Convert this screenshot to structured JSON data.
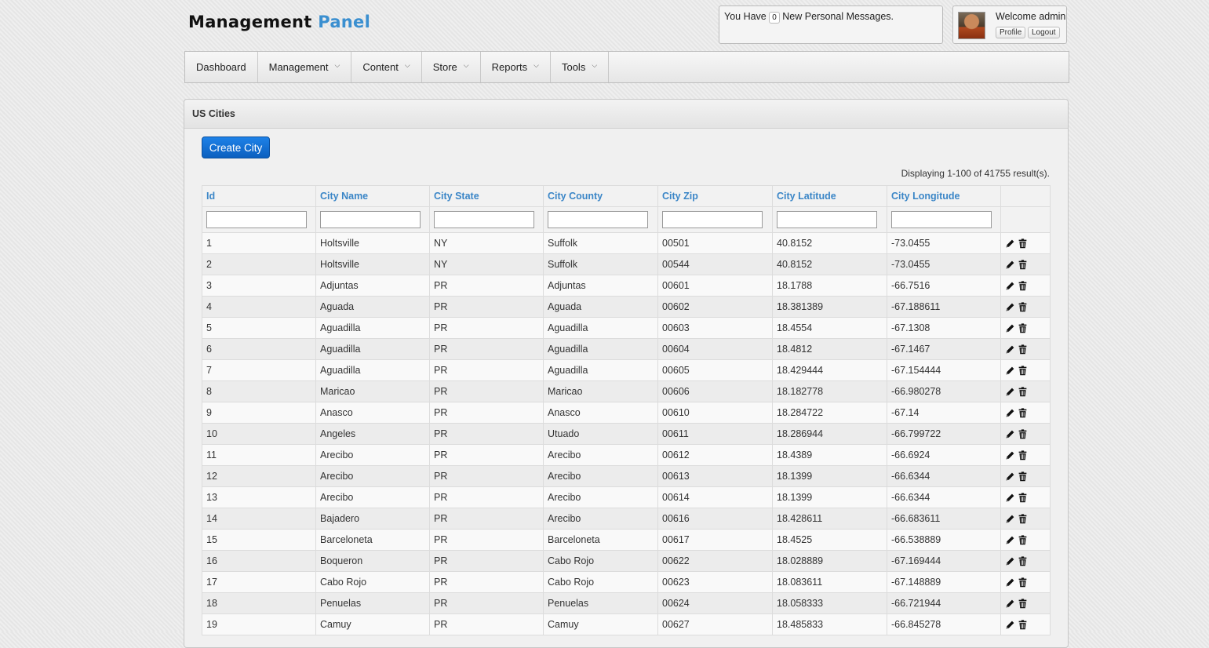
{
  "header": {
    "logo_main": "Management",
    "logo_accent": "Panel",
    "messages_prefix": "You Have",
    "messages_count": "0",
    "messages_suffix": "New Personal Messages.",
    "welcome": "Welcome admin",
    "profile_label": "Profile",
    "logout_label": "Logout"
  },
  "nav": [
    {
      "label": "Dashboard",
      "dropdown": false
    },
    {
      "label": "Management",
      "dropdown": true
    },
    {
      "label": "Content",
      "dropdown": true
    },
    {
      "label": "Store",
      "dropdown": true
    },
    {
      "label": "Reports",
      "dropdown": true
    },
    {
      "label": "Tools",
      "dropdown": true
    }
  ],
  "panel": {
    "title": "US Cities",
    "create_label": "Create City",
    "summary": "Displaying 1-100 of 41755 result(s)."
  },
  "columns": [
    "Id",
    "City Name",
    "City State",
    "City County",
    "City Zip",
    "City Latitude",
    "City Longitude"
  ],
  "icons": {
    "edit": "pencil-icon",
    "delete": "trash-icon"
  },
  "rows": [
    [
      "1",
      "Holtsville",
      "NY",
      "Suffolk",
      "00501",
      "40.8152",
      "-73.0455"
    ],
    [
      "2",
      "Holtsville",
      "NY",
      "Suffolk",
      "00544",
      "40.8152",
      "-73.0455"
    ],
    [
      "3",
      "Adjuntas",
      "PR",
      "Adjuntas",
      "00601",
      "18.1788",
      "-66.7516"
    ],
    [
      "4",
      "Aguada",
      "PR",
      "Aguada",
      "00602",
      "18.381389",
      "-67.188611"
    ],
    [
      "5",
      "Aguadilla",
      "PR",
      "Aguadilla",
      "00603",
      "18.4554",
      "-67.1308"
    ],
    [
      "6",
      "Aguadilla",
      "PR",
      "Aguadilla",
      "00604",
      "18.4812",
      "-67.1467"
    ],
    [
      "7",
      "Aguadilla",
      "PR",
      "Aguadilla",
      "00605",
      "18.429444",
      "-67.154444"
    ],
    [
      "8",
      "Maricao",
      "PR",
      "Maricao",
      "00606",
      "18.182778",
      "-66.980278"
    ],
    [
      "9",
      "Anasco",
      "PR",
      "Anasco",
      "00610",
      "18.284722",
      "-67.14"
    ],
    [
      "10",
      "Angeles",
      "PR",
      "Utuado",
      "00611",
      "18.286944",
      "-66.799722"
    ],
    [
      "11",
      "Arecibo",
      "PR",
      "Arecibo",
      "00612",
      "18.4389",
      "-66.6924"
    ],
    [
      "12",
      "Arecibo",
      "PR",
      "Arecibo",
      "00613",
      "18.1399",
      "-66.6344"
    ],
    [
      "13",
      "Arecibo",
      "PR",
      "Arecibo",
      "00614",
      "18.1399",
      "-66.6344"
    ],
    [
      "14",
      "Bajadero",
      "PR",
      "Arecibo",
      "00616",
      "18.428611",
      "-66.683611"
    ],
    [
      "15",
      "Barceloneta",
      "PR",
      "Barceloneta",
      "00617",
      "18.4525",
      "-66.538889"
    ],
    [
      "16",
      "Boqueron",
      "PR",
      "Cabo Rojo",
      "00622",
      "18.028889",
      "-67.169444"
    ],
    [
      "17",
      "Cabo Rojo",
      "PR",
      "Cabo Rojo",
      "00623",
      "18.083611",
      "-67.148889"
    ],
    [
      "18",
      "Penuelas",
      "PR",
      "Penuelas",
      "00624",
      "18.058333",
      "-66.721944"
    ],
    [
      "19",
      "Camuy",
      "PR",
      "Camuy",
      "00627",
      "18.485833",
      "-66.845278"
    ]
  ]
}
